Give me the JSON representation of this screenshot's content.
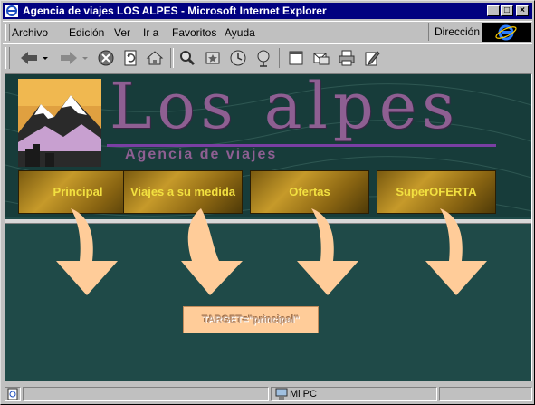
{
  "window": {
    "title": "Agencia de viajes LOS ALPES - Microsoft Internet Explorer",
    "buttons": {
      "minimize": "_",
      "maximize": "□",
      "close": "×"
    }
  },
  "menu": {
    "items": [
      {
        "label": "Archivo"
      },
      {
        "label": "Edición"
      },
      {
        "label": "Ver"
      },
      {
        "label": "Ir a"
      },
      {
        "label": "Favoritos"
      },
      {
        "label": "Ayuda"
      }
    ],
    "address_label": "Dirección"
  },
  "toolbar": {
    "icons": [
      "back-icon",
      "forward-icon",
      "stop-icon",
      "refresh-icon",
      "home-icon",
      "search-icon",
      "favorites-icon",
      "history-icon",
      "channels-icon",
      "fullscreen-icon",
      "mail-icon",
      "print-icon",
      "edit-icon"
    ]
  },
  "page": {
    "brand": "Los alpes",
    "subtitle": "Agencia de viajes",
    "nav": [
      {
        "label": "Principal"
      },
      {
        "label": "Viajes a su medida"
      },
      {
        "label": "Ofertas"
      },
      {
        "label": "SuperOFERTA"
      }
    ],
    "target_text": "TARGET=\"principal\"",
    "colors": {
      "background": "#1f4a48",
      "brand": "#8e5f92",
      "button_text": "#f2e040",
      "arrow": "#ffcc99"
    }
  },
  "status": {
    "zone": "Mi PC"
  }
}
